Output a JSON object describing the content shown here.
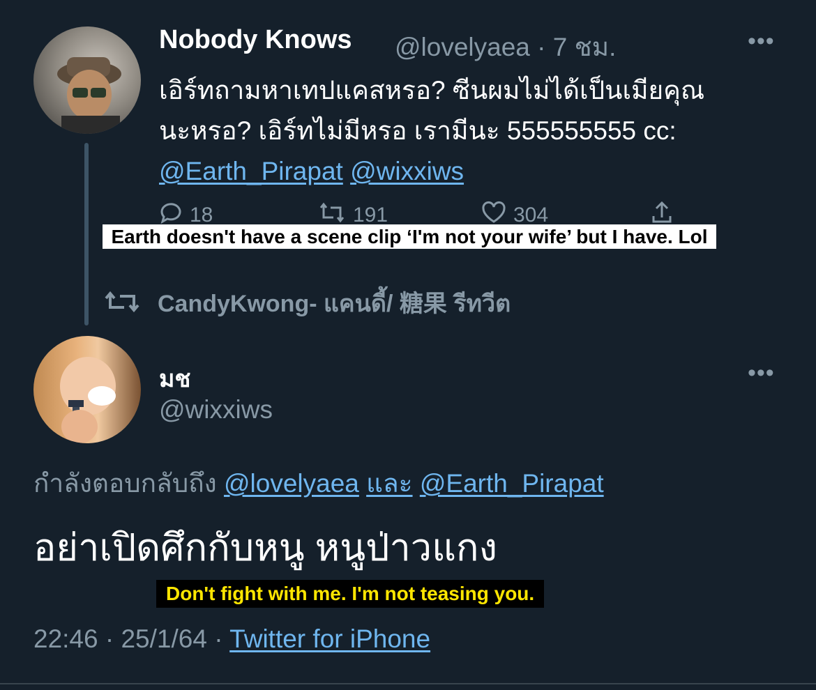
{
  "tweet1": {
    "name": "Nobody Knows",
    "handle": "@lovelyaea",
    "separator": "·",
    "time": "7 ชม.",
    "more": "•••",
    "text_line1": "เอิร์ทถามหาเทปแคสหรอ? ซีนผมไม่ได้เป็นเมียคุณ",
    "text_line2": "นะหรอ? เอิร์ทไม่มีหรอ เรามีนะ 555555555 cc:",
    "mention1": "@Earth_Pirapat",
    "mention2": "@wixxiws",
    "replies": "18",
    "retweets": "191",
    "likes": "304"
  },
  "caption_top": "Earth doesn't have a scene clip ‘I'm not your wife’ but I have. Lol",
  "retweet_bar": {
    "text": "CandyKwong- แคนดี้/ 糖果 รีทวีต"
  },
  "tweet2": {
    "name": "มช",
    "handle": "@wixxiws",
    "more": "•••",
    "replying_prefix": "กำลังตอบกลับถึง",
    "replying_user1": "@lovelyaea",
    "replying_and": "และ",
    "replying_user2": "@Earth_Pirapat",
    "text": "อย่าเปิดศึกกับหนู หนูป่าวแกง",
    "time": "22:46",
    "date": "25/1/64",
    "source": "Twitter for iPhone",
    "dot": "·"
  },
  "caption_bottom": "Don't fight with me. I'm not teasing you.",
  "colors": {
    "background": "#15202b",
    "link": "#6fb6ef",
    "muted": "#8899a6",
    "caption_yellow": "#ffe600"
  }
}
